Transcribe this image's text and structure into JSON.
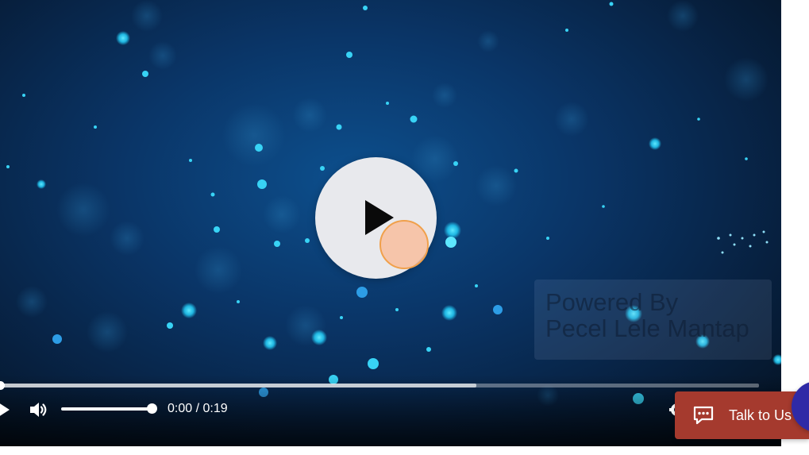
{
  "video_player": {
    "watermark": {
      "line1": "Powered By",
      "line2": "Pecel Lele Mantap"
    },
    "controls": {
      "time_display": "0:00 / 0:19",
      "progress_fraction": 0,
      "buffered_fraction": 0.628,
      "volume_fraction": 1.0
    },
    "icons": {
      "play_overlay": "play-icon",
      "play": "play-icon",
      "volume": "volume-icon",
      "settings": "gear-icon"
    }
  },
  "chat_widget": {
    "label": "Talk to Us",
    "icon": "chat-bubble-icon",
    "background_color": "#a53a2e",
    "badge_color": "#2f2aa6"
  },
  "colors": {
    "click_indicator": "#f7bfa0"
  }
}
